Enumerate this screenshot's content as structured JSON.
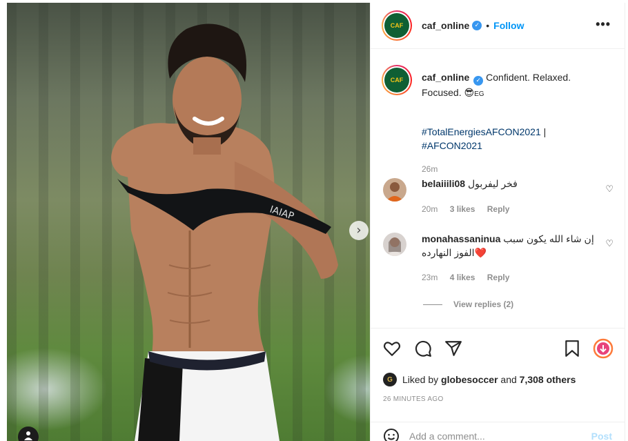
{
  "post": {
    "author": "caf_online",
    "author_logo_text": "CAF",
    "follow_label": "Follow",
    "dot": "•",
    "more_label": "•••",
    "verified_mark": "✓",
    "caption": "Confident. Relaxed. Focused. 😎",
    "caption_flag": "EG",
    "hashtags": [
      "#TotalEnergiesAFCON2021",
      "#AFCON2021"
    ],
    "hashtag_separator": " |",
    "caption_age": "26m",
    "carousel_next_icon": "chevron-right-icon",
    "carousel_next_glyph": "›"
  },
  "comments": [
    {
      "username": "belaiiili08",
      "text": "فخر ليفربول",
      "age": "20m",
      "likes": "3 likes",
      "reply_label": "Reply",
      "heart": "♡"
    },
    {
      "username": "monahassaninua",
      "text": "إن شاء الله يكون سبب الفوز النهارده",
      "emoji": "❤️",
      "age": "23m",
      "likes": "4 likes",
      "reply_label": "Reply",
      "heart": "♡"
    }
  ],
  "view_replies": "View replies (2)",
  "actions": {
    "like_icon": "heart-icon",
    "comment_icon": "comment-icon",
    "share_icon": "share-icon",
    "save_icon": "bookmark-icon",
    "extra_icon": "download-icon"
  },
  "likes": {
    "prefix": "Liked by",
    "user": "globesoccer",
    "and": "and",
    "others": "7,308 others",
    "avatar_letter": "G"
  },
  "post_time": "26 MINUTES AGO",
  "comment_box": {
    "placeholder": "Add a comment...",
    "post_label": "Post",
    "emoji_icon": "emoji-icon"
  },
  "colors": {
    "accent": "#0095f6",
    "hashtag": "#00376b",
    "muted": "#8e8e8e",
    "heart_red": "#ed4956"
  }
}
